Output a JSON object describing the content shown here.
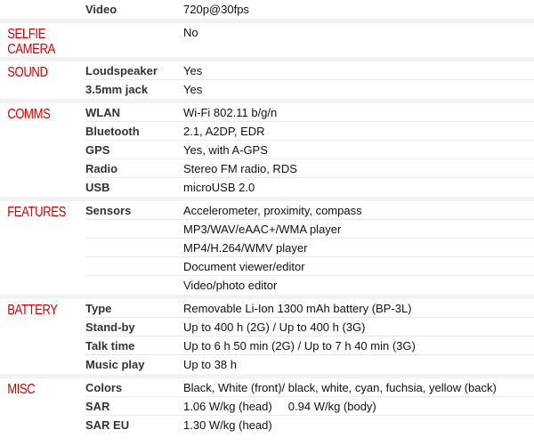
{
  "top_row": {
    "label": "Video",
    "value": "720p@30fps"
  },
  "sections": [
    {
      "category": "SELFIE CAMERA",
      "rows": [
        {
          "label": "",
          "value": "No"
        }
      ]
    },
    {
      "category": "SOUND",
      "rows": [
        {
          "label": "Loudspeaker",
          "value": "Yes"
        },
        {
          "label": "3.5mm jack",
          "value": "Yes"
        }
      ]
    },
    {
      "category": "COMMS",
      "rows": [
        {
          "label": "WLAN",
          "value": "Wi-Fi 802.11 b/g/n"
        },
        {
          "label": "Bluetooth",
          "value": "2.1, A2DP, EDR"
        },
        {
          "label": "GPS",
          "value": "Yes, with A-GPS"
        },
        {
          "label": "Radio",
          "value": "Stereo FM radio, RDS"
        },
        {
          "label": "USB",
          "value": "microUSB 2.0"
        }
      ]
    },
    {
      "category": "FEATURES",
      "rows": [
        {
          "label": "Sensors",
          "value": "Accelerometer, proximity, compass"
        },
        {
          "label": "",
          "value": "MP3/WAV/eAAC+/WMA player"
        },
        {
          "label": "",
          "value": "MP4/H.264/WMV player"
        },
        {
          "label": "",
          "value": "Document viewer/editor"
        },
        {
          "label": "",
          "value": "Video/photo editor"
        }
      ]
    },
    {
      "category": "BATTERY",
      "rows": [
        {
          "label": "Type",
          "value": "Removable Li-Ion 1300 mAh battery (BP-3L)"
        },
        {
          "label": "Stand-by",
          "value": "Up to 400 h (2G) / Up to 400 h (3G)"
        },
        {
          "label": "Talk time",
          "value": "Up to 6 h 50 min (2G) / Up to 7 h 40 min (3G)"
        },
        {
          "label": "Music play",
          "value": "Up to 38 h"
        }
      ]
    },
    {
      "category": "MISC",
      "rows": [
        {
          "label": "Colors",
          "value": "Black, White (front)/ black, white, cyan, fuchsia, yellow (back)"
        },
        {
          "label": "SAR",
          "value": "1.06 W/kg (head)     0.94 W/kg (body)"
        },
        {
          "label": "SAR EU",
          "value": "1.30 W/kg (head)"
        }
      ]
    }
  ]
}
